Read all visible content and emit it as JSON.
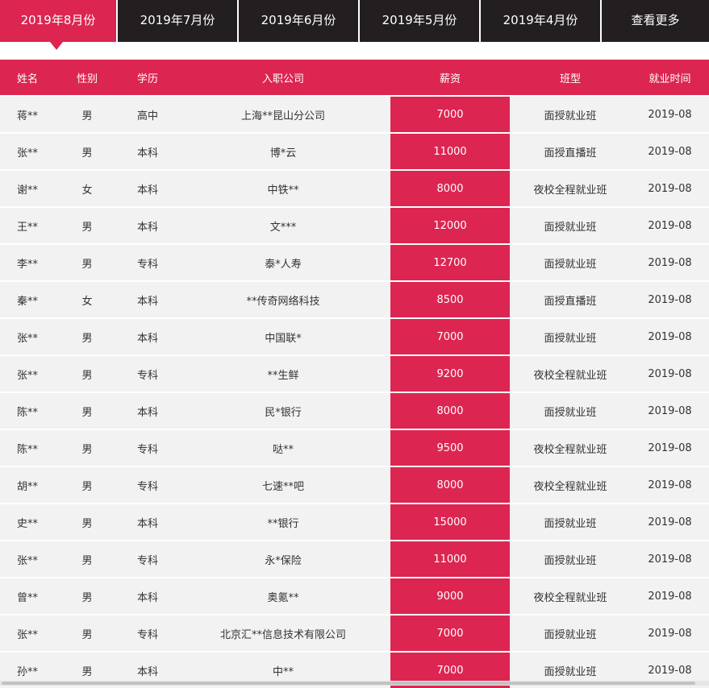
{
  "tabs": [
    {
      "label": "2019年8月份",
      "active": true
    },
    {
      "label": "2019年7月份",
      "active": false
    },
    {
      "label": "2019年6月份",
      "active": false
    },
    {
      "label": "2019年5月份",
      "active": false
    },
    {
      "label": "2019年4月份",
      "active": false
    },
    {
      "label": "查看更多",
      "active": false
    }
  ],
  "colors": {
    "accent": "#dd2551",
    "tab_bar": "#231f20",
    "row_bg": "#f2f2f2"
  },
  "table": {
    "headers": [
      "姓名",
      "性别",
      "学历",
      "入职公司",
      "薪资",
      "班型",
      "就业时间"
    ],
    "rows": [
      [
        "蒋**",
        "男",
        "高中",
        "上海**昆山分公司",
        "7000",
        "面授就业班",
        "2019-08"
      ],
      [
        "张**",
        "男",
        "本科",
        "博*云",
        "11000",
        "面授直播班",
        "2019-08"
      ],
      [
        "谢**",
        "女",
        "本科",
        "中铁**",
        "8000",
        "夜校全程就业班",
        "2019-08"
      ],
      [
        "王**",
        "男",
        "本科",
        "文***",
        "12000",
        "面授就业班",
        "2019-08"
      ],
      [
        "李**",
        "男",
        "专科",
        "泰*人寿",
        "12700",
        "面授就业班",
        "2019-08"
      ],
      [
        "秦**",
        "女",
        "本科",
        "**传奇网络科技",
        "8500",
        "面授直播班",
        "2019-08"
      ],
      [
        "张**",
        "男",
        "本科",
        "中国联*",
        "7000",
        "面授就业班",
        "2019-08"
      ],
      [
        "张**",
        "男",
        "专科",
        "**生鲜",
        "9200",
        "夜校全程就业班",
        "2019-08"
      ],
      [
        "陈**",
        "男",
        "本科",
        "民*银行",
        "8000",
        "面授就业班",
        "2019-08"
      ],
      [
        "陈**",
        "男",
        "专科",
        "哒**",
        "9500",
        "夜校全程就业班",
        "2019-08"
      ],
      [
        "胡**",
        "男",
        "专科",
        "七速**吧",
        "8000",
        "夜校全程就业班",
        "2019-08"
      ],
      [
        "史**",
        "男",
        "本科",
        "**银行",
        "15000",
        "面授就业班",
        "2019-08"
      ],
      [
        "张**",
        "男",
        "专科",
        "永*保险",
        "11000",
        "面授就业班",
        "2019-08"
      ],
      [
        "曾**",
        "男",
        "本科",
        "奥氪**",
        "9000",
        "夜校全程就业班",
        "2019-08"
      ],
      [
        "张**",
        "男",
        "专科",
        "北京汇**信息技术有限公司",
        "7000",
        "面授就业班",
        "2019-08"
      ],
      [
        "孙**",
        "男",
        "本科",
        "中**",
        "7000",
        "面授就业班",
        "2019-08"
      ]
    ]
  }
}
